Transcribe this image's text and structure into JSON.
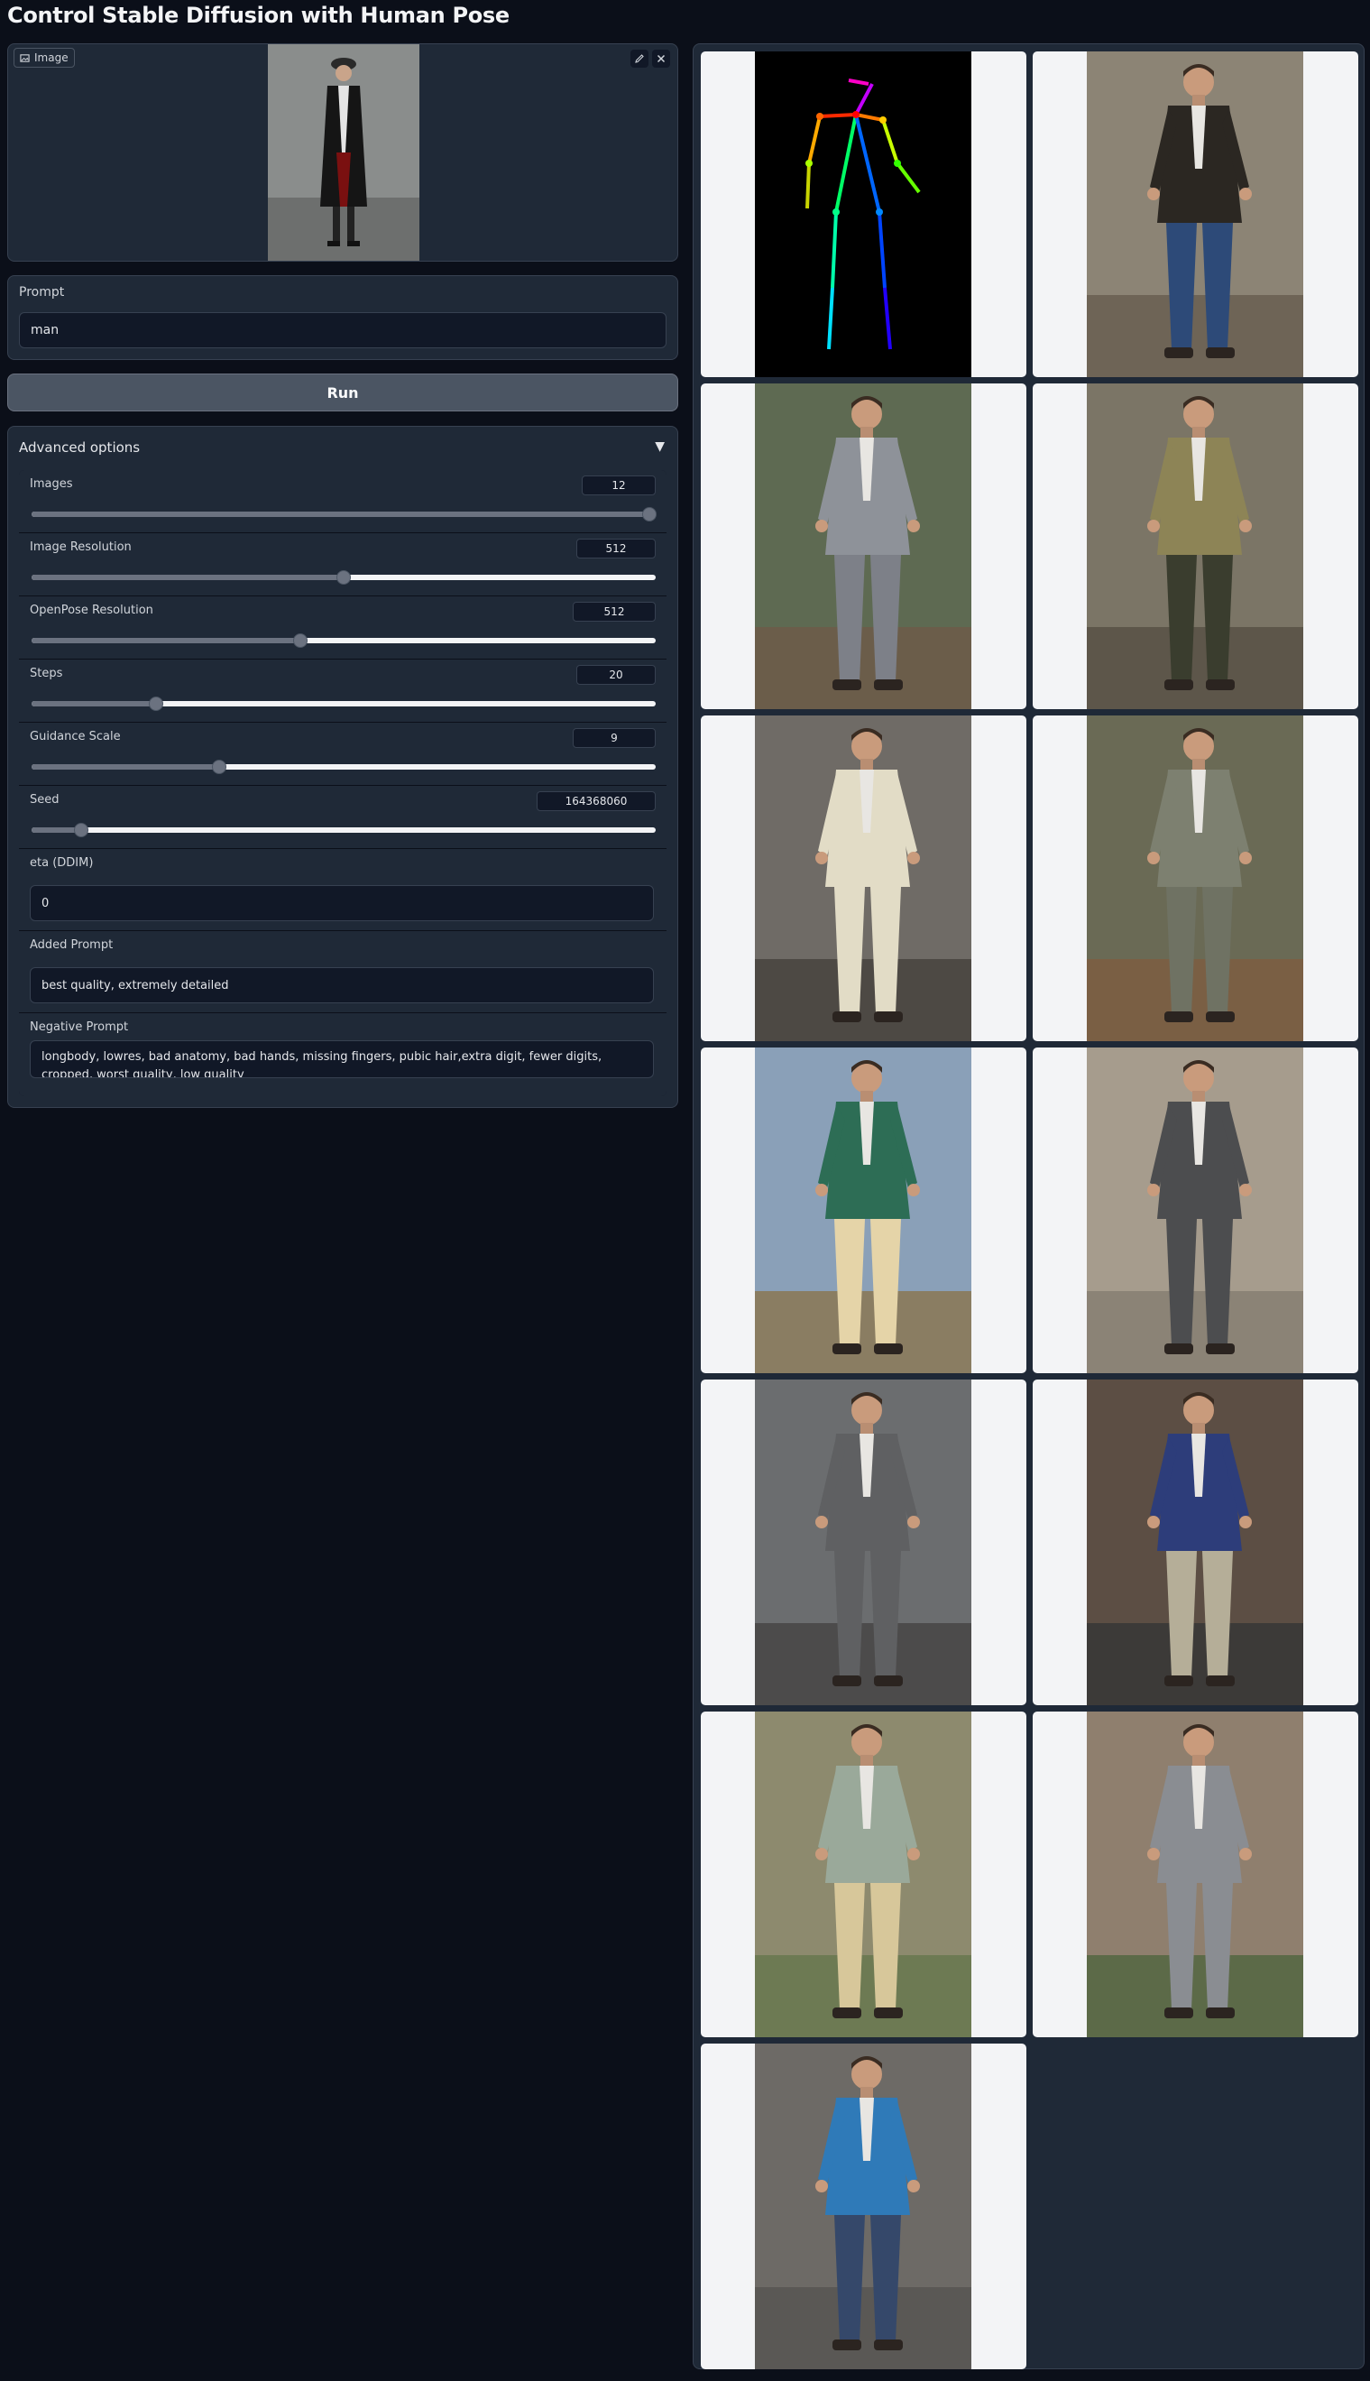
{
  "app": {
    "title": "Control Stable Diffusion with Human Pose"
  },
  "image_input": {
    "label": "Image"
  },
  "prompt": {
    "label": "Prompt",
    "value": "man"
  },
  "run_button": {
    "label": "Run"
  },
  "advanced": {
    "title": "Advanced options",
    "toggle": "▼",
    "sliders": [
      {
        "label": "Images",
        "value": "12",
        "fraction": 0.99
      },
      {
        "label": "Image Resolution",
        "value": "512",
        "fraction": 0.5
      },
      {
        "label": "OpenPose Resolution",
        "value": "512",
        "fraction": 0.43
      },
      {
        "label": "Steps",
        "value": "20",
        "fraction": 0.2
      },
      {
        "label": "Guidance Scale",
        "value": "9",
        "fraction": 0.3
      },
      {
        "label": "Seed",
        "value": "164368060",
        "fraction": 0.08
      }
    ],
    "eta": {
      "label": "eta (DDIM)",
      "value": "0"
    },
    "added_prompt": {
      "label": "Added Prompt",
      "value": "best quality, extremely detailed"
    },
    "negative_prompt": {
      "label": "Negative Prompt",
      "value": "longbody, lowres, bad anatomy, bad hands, missing fingers, pubic hair,extra digit, fewer digits, cropped, worst quality, low quality"
    }
  },
  "gallery": {
    "images": [
      {
        "kind": "pose",
        "bg": "#000000"
      },
      {
        "kind": "person",
        "bg": "#8c8475",
        "ground": "#6e6456",
        "jacket": "#2b2722",
        "pants": "#2d4a78"
      },
      {
        "kind": "person",
        "bg": "#5e6a52",
        "ground": "#6b5d4a",
        "jacket": "#8e9299",
        "pants": "#7d8088"
      },
      {
        "kind": "person",
        "bg": "#7b7566",
        "ground": "#5d564a",
        "jacket": "#8d8456",
        "pants": "#3a3d2e"
      },
      {
        "kind": "person",
        "bg": "#6f6b66",
        "ground": "#4d4944",
        "jacket": "#e2dcc6",
        "pants": "#e2dcc6"
      },
      {
        "kind": "person",
        "bg": "#6a6a55",
        "ground": "#7a5f44",
        "jacket": "#7d8070",
        "pants": "#6f7263"
      },
      {
        "kind": "person",
        "bg": "#8aa0b8",
        "ground": "#8a7d62",
        "jacket": "#2d6d55",
        "pants": "#e5d4a8"
      },
      {
        "kind": "person",
        "bg": "#a69c8d",
        "ground": "#8b8376",
        "jacket": "#4c4d4f",
        "pants": "#4c4d4f"
      },
      {
        "kind": "person",
        "bg": "#6b6d6f",
        "ground": "#4c4b4b",
        "jacket": "#5f6062",
        "pants": "#5f6062"
      },
      {
        "kind": "person",
        "bg": "#5c4e44",
        "ground": "#3c3a38",
        "jacket": "#2d3d7a",
        "pants": "#b5ae98"
      },
      {
        "kind": "person",
        "bg": "#8d8a6e",
        "ground": "#6d7a53",
        "jacket": "#9aa99a",
        "pants": "#d7c79a"
      },
      {
        "kind": "person",
        "bg": "#8f7f6e",
        "ground": "#5c6a48",
        "jacket": "#8a8d92",
        "pants": "#8a8d92"
      },
      {
        "kind": "person",
        "bg": "#6d6a66",
        "ground": "#5a5855",
        "jacket": "#2f7ab8",
        "pants": "#35486a"
      }
    ]
  }
}
